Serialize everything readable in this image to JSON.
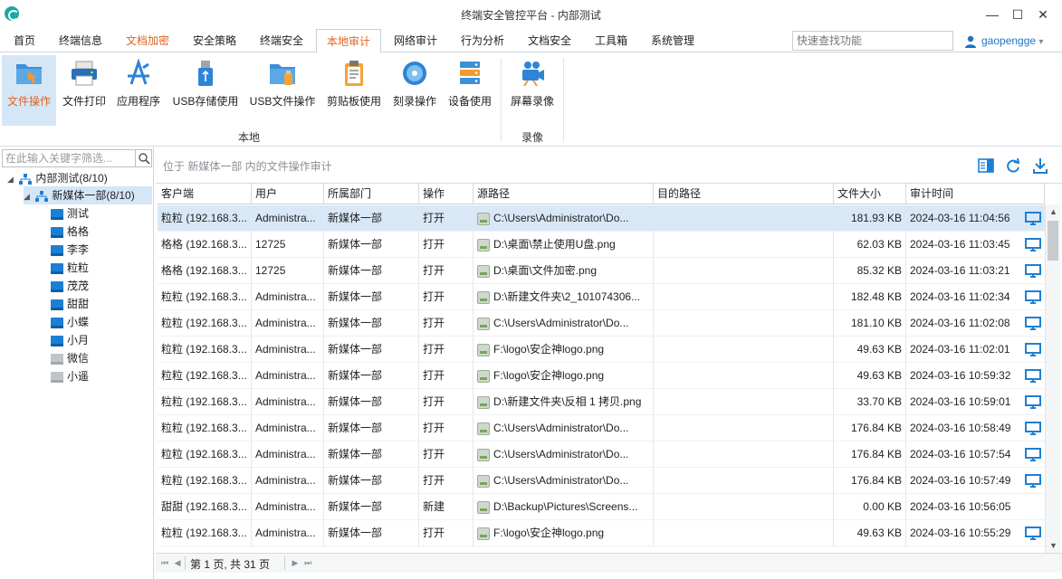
{
  "window": {
    "title": "终端安全管控平台 - 内部测试",
    "minimize": "—",
    "maximize": "☐",
    "close": "✕"
  },
  "menu": {
    "tabs": [
      "首页",
      "终端信息",
      "文档加密",
      "安全策略",
      "终端安全",
      "本地审计",
      "网络审计",
      "行为分析",
      "文档安全",
      "工具箱",
      "系统管理"
    ],
    "active_tab": "本地审计",
    "search_placeholder": "快速查找功能",
    "user": "gaopengge",
    "user_dropdown": "▾"
  },
  "ribbon": {
    "buttons": [
      "文件操作",
      "文件打印",
      "应用程序",
      "USB存储使用",
      "USB文件操作",
      "剪贴板使用",
      "刻录操作",
      "设备使用",
      "屏幕录像"
    ],
    "active_button": "文件操作",
    "groups": [
      "本地",
      "录像"
    ]
  },
  "tree": {
    "search_placeholder": "在此输入关键字筛选...",
    "root": "内部测试(8/10)",
    "dept": "新媒体一部(8/10)",
    "users": [
      {
        "name": "测试",
        "online": true
      },
      {
        "name": "格格",
        "online": true
      },
      {
        "name": "李李",
        "online": true
      },
      {
        "name": "粒粒",
        "online": true
      },
      {
        "name": "茂茂",
        "online": true
      },
      {
        "name": "甜甜",
        "online": true
      },
      {
        "name": "小蝶",
        "online": true
      },
      {
        "name": "小月",
        "online": true
      },
      {
        "name": "微信",
        "online": false
      },
      {
        "name": "小遥",
        "online": false
      }
    ]
  },
  "content": {
    "location_text": "位于 新媒体一部 内的文件操作审计",
    "columns": [
      "客户端",
      "用户",
      "所属部门",
      "操作",
      "源路径",
      "目的路径",
      "文件大小",
      "审计时间"
    ],
    "rows": [
      {
        "client": "粒粒 (192.168.3...",
        "user": "Administra...",
        "dept": "新媒体一部",
        "op": "打开",
        "src": "C:\\Users\\Administrator\\Do...",
        "dst": "",
        "size": "181.93 KB",
        "time": "2024-03-16 11:04:56",
        "monitor": true
      },
      {
        "client": "格格 (192.168.3...",
        "user": "12725",
        "dept": "新媒体一部",
        "op": "打开",
        "src": "D:\\桌面\\禁止使用U盘.png",
        "dst": "",
        "size": "62.03 KB",
        "time": "2024-03-16 11:03:45",
        "monitor": true
      },
      {
        "client": "格格 (192.168.3...",
        "user": "12725",
        "dept": "新媒体一部",
        "op": "打开",
        "src": "D:\\桌面\\文件加密.png",
        "dst": "",
        "size": "85.32 KB",
        "time": "2024-03-16 11:03:21",
        "monitor": true
      },
      {
        "client": "粒粒 (192.168.3...",
        "user": "Administra...",
        "dept": "新媒体一部",
        "op": "打开",
        "src": "D:\\新建文件夹\\2_101074306...",
        "dst": "",
        "size": "182.48 KB",
        "time": "2024-03-16 11:02:34",
        "monitor": true
      },
      {
        "client": "粒粒 (192.168.3...",
        "user": "Administra...",
        "dept": "新媒体一部",
        "op": "打开",
        "src": "C:\\Users\\Administrator\\Do...",
        "dst": "",
        "size": "181.10 KB",
        "time": "2024-03-16 11:02:08",
        "monitor": true
      },
      {
        "client": "粒粒 (192.168.3...",
        "user": "Administra...",
        "dept": "新媒体一部",
        "op": "打开",
        "src": "F:\\logo\\安企神logo.png",
        "dst": "",
        "size": "49.63 KB",
        "time": "2024-03-16 11:02:01",
        "monitor": true
      },
      {
        "client": "粒粒 (192.168.3...",
        "user": "Administra...",
        "dept": "新媒体一部",
        "op": "打开",
        "src": "F:\\logo\\安企神logo.png",
        "dst": "",
        "size": "49.63 KB",
        "time": "2024-03-16 10:59:32",
        "monitor": true
      },
      {
        "client": "粒粒 (192.168.3...",
        "user": "Administra...",
        "dept": "新媒体一部",
        "op": "打开",
        "src": "D:\\新建文件夹\\反相 1 拷贝.png",
        "dst": "",
        "size": "33.70 KB",
        "time": "2024-03-16 10:59:01",
        "monitor": true
      },
      {
        "client": "粒粒 (192.168.3...",
        "user": "Administra...",
        "dept": "新媒体一部",
        "op": "打开",
        "src": "C:\\Users\\Administrator\\Do...",
        "dst": "",
        "size": "176.84 KB",
        "time": "2024-03-16 10:58:49",
        "monitor": true
      },
      {
        "client": "粒粒 (192.168.3...",
        "user": "Administra...",
        "dept": "新媒体一部",
        "op": "打开",
        "src": "C:\\Users\\Administrator\\Do...",
        "dst": "",
        "size": "176.84 KB",
        "time": "2024-03-16 10:57:54",
        "monitor": true
      },
      {
        "client": "粒粒 (192.168.3...",
        "user": "Administra...",
        "dept": "新媒体一部",
        "op": "打开",
        "src": "C:\\Users\\Administrator\\Do...",
        "dst": "",
        "size": "176.84 KB",
        "time": "2024-03-16 10:57:49",
        "monitor": true
      },
      {
        "client": "甜甜 (192.168.3...",
        "user": "Administra...",
        "dept": "新媒体一部",
        "op": "新建",
        "src": "D:\\Backup\\Pictures\\Screens...",
        "dst": "",
        "size": "0.00 KB",
        "time": "2024-03-16 10:56:05",
        "monitor": false
      },
      {
        "client": "粒粒 (192.168.3...",
        "user": "Administra...",
        "dept": "新媒体一部",
        "op": "打开",
        "src": "F:\\logo\\安企神logo.png",
        "dst": "",
        "size": "49.63 KB",
        "time": "2024-03-16 10:55:29",
        "monitor": true
      }
    ],
    "pager_text": "第 1 页, 共 31 页"
  },
  "colors": {
    "accent": "#1c7fd6",
    "active_tab_text": "#e0641d",
    "selected_bg": "#d9e8f7"
  }
}
